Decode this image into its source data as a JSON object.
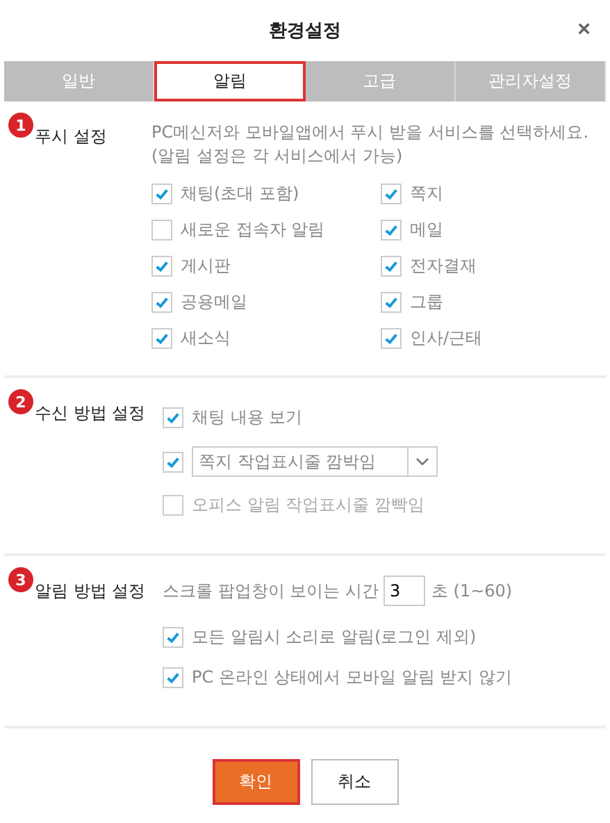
{
  "window": {
    "title": "환경설정",
    "close": "×"
  },
  "tabs": [
    {
      "label": "일반",
      "selected": false
    },
    {
      "label": "알림",
      "selected": true
    },
    {
      "label": "고급",
      "selected": false
    },
    {
      "label": "관리자설정",
      "selected": false
    }
  ],
  "sections": [
    {
      "badge": "1",
      "label": "푸시 설정",
      "description": [
        "PC메신저와 모바일앱에서 푸시 받을 서비스를 선택하세요.",
        "(알림 설정은 각 서비스에서 가능)"
      ],
      "rows": [
        {
          "kind": "grid",
          "items": [
            {
              "label": "채팅(초대 포함)",
              "checked": true
            },
            {
              "label": "쪽지",
              "checked": true
            },
            {
              "label": "새로운 접속자 알림",
              "checked": false
            },
            {
              "label": "메일",
              "checked": true
            },
            {
              "label": "게시판",
              "checked": true
            },
            {
              "label": "전자결재",
              "checked": true
            },
            {
              "label": "공용메일",
              "checked": true
            },
            {
              "label": "그룹",
              "checked": true
            },
            {
              "label": "새소식",
              "checked": true
            },
            {
              "label": "인사/근태",
              "checked": true
            }
          ]
        }
      ]
    },
    {
      "badge": "2",
      "label": "수신 방법 설정",
      "rows": [
        {
          "kind": "checkbox",
          "label": "채팅 내용 보기",
          "checked": true
        },
        {
          "kind": "select",
          "value": "쪽지 작업표시줄 깜박임",
          "checked": true
        },
        {
          "kind": "checkbox",
          "label": "오피스 알림 작업표시줄 깜빡임",
          "checked": false
        }
      ]
    },
    {
      "badge": "3",
      "label": "알림 방법 설정",
      "rows": [
        {
          "kind": "duration",
          "prefix": "스크롤 팝업창이 보이는 시간",
          "value": "3",
          "suffix": "초 (1~60)"
        },
        {
          "kind": "checkbox",
          "label": "모든 알림시 소리로 알림(로그인 제외)",
          "checked": true
        },
        {
          "kind": "checkbox",
          "label": "PC 온라인 상태에서 모바일 알림 받지 않기",
          "checked": true
        }
      ]
    }
  ],
  "buttons": [
    {
      "label": "확인",
      "kind": "primary"
    },
    {
      "label": "취소",
      "kind": "secondary"
    }
  ]
}
